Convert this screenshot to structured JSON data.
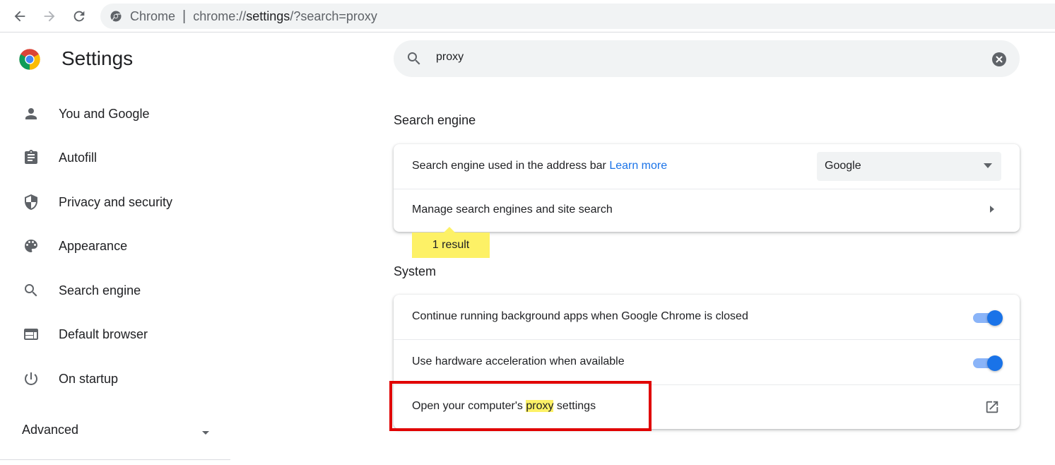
{
  "browser": {
    "omnibox_label": "Chrome",
    "omnibox_separator": "|",
    "url_prefix": "chrome://",
    "url_host": "settings",
    "url_rest": "/?search=proxy"
  },
  "sidebar": {
    "title": "Settings",
    "items": [
      {
        "label": "You and Google",
        "icon": "person-icon"
      },
      {
        "label": "Autofill",
        "icon": "clipboard-icon"
      },
      {
        "label": "Privacy and security",
        "icon": "shield-icon"
      },
      {
        "label": "Appearance",
        "icon": "palette-icon"
      },
      {
        "label": "Search engine",
        "icon": "search-icon"
      },
      {
        "label": "Default browser",
        "icon": "browser-window-icon"
      },
      {
        "label": "On startup",
        "icon": "power-icon"
      }
    ],
    "advanced_label": "Advanced"
  },
  "search": {
    "value": "proxy"
  },
  "sections": {
    "search_engine": {
      "title": "Search engine",
      "row1_label": "Search engine used in the address bar",
      "row1_link": "Learn more",
      "row1_select_value": "Google",
      "row2_label": "Manage search engines and site search",
      "bubble": "1 result"
    },
    "system": {
      "title": "System",
      "row1_label": "Continue running background apps when Google Chrome is closed",
      "row1_toggle_on": true,
      "row2_label": "Use hardware acceleration when available",
      "row2_toggle_on": true,
      "row3_label_before": "Open your computer's ",
      "row3_label_highlight": "proxy",
      "row3_label_after": " settings"
    }
  },
  "colors": {
    "accent": "#1a73e8",
    "highlight": "#fdf166",
    "annotation": "#e00000"
  }
}
